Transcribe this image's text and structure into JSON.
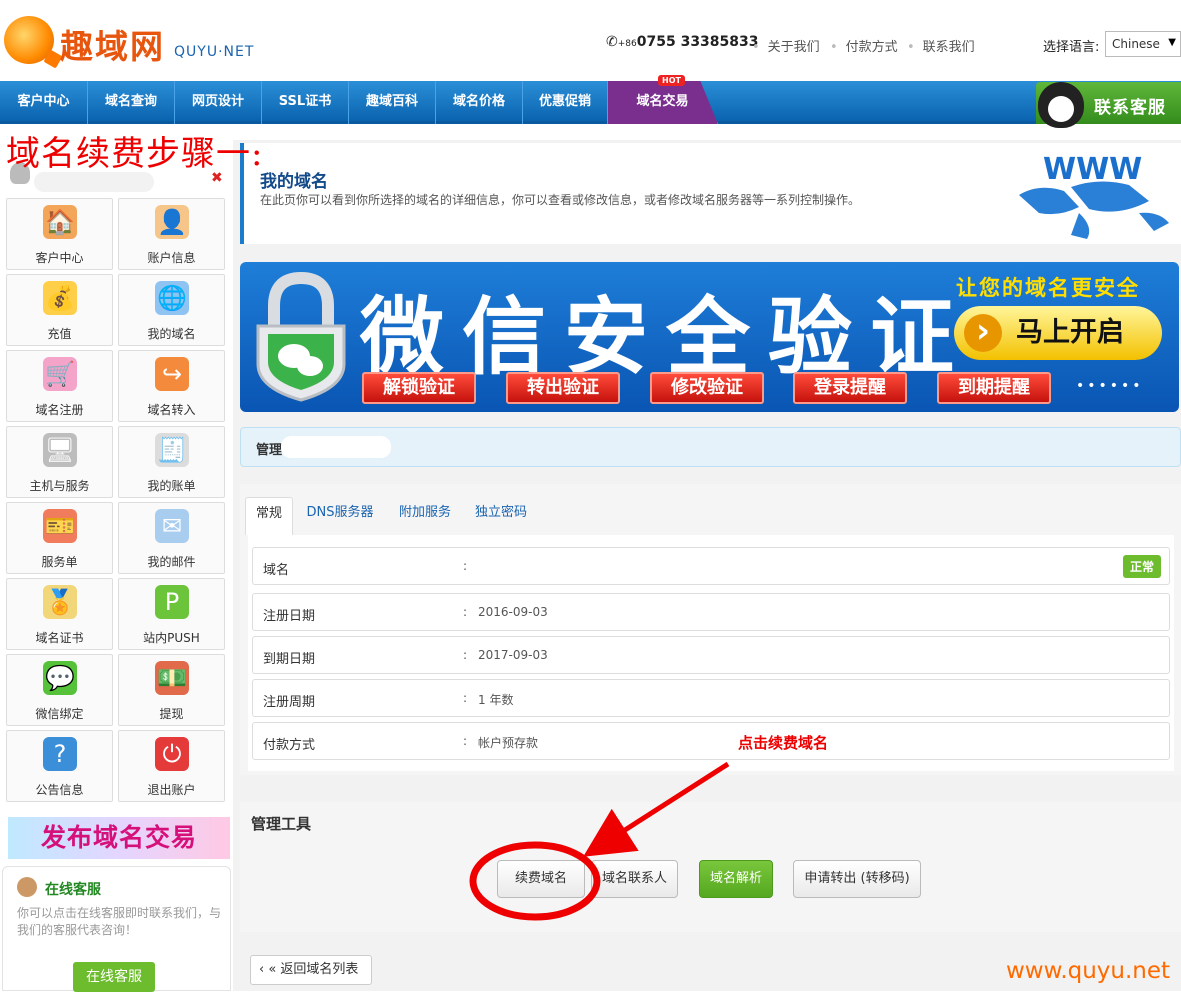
{
  "header": {
    "brand_cn": "趣域网",
    "brand_en": "QUYU·NET",
    "phone_prefix": "+86",
    "phone": "0755 33385833",
    "links": [
      "关于我们",
      "付款方式",
      "联系我们"
    ],
    "lang_label": "选择语言:",
    "lang_selected": "Chinese"
  },
  "nav": {
    "items": [
      "客户中心",
      "域名查询",
      "网页设计",
      "SSL证书",
      "趣域百科",
      "域名价格",
      "优惠促销",
      "域名交易"
    ],
    "hot_badge": "HOT",
    "contact_label": "联系客服"
  },
  "step_title": "域名续费步骤一:",
  "sidebar": {
    "tiles": [
      {
        "label": "客户中心",
        "icon": "house-icon",
        "glyph": "🏠",
        "color": "#f3a55a"
      },
      {
        "label": "账户信息",
        "icon": "user-icon",
        "glyph": "👤",
        "color": "#f6c58a"
      },
      {
        "label": "充值",
        "icon": "coins-icon",
        "glyph": "💰",
        "color": "#ffcf4a"
      },
      {
        "label": "我的域名",
        "icon": "globe-icon",
        "glyph": "🌐",
        "color": "#8fc3f2"
      },
      {
        "label": "域名注册",
        "icon": "cart-icon",
        "glyph": "🛒",
        "color": "#f4a3c9"
      },
      {
        "label": "域名转入",
        "icon": "transfer-icon",
        "glyph": "↪",
        "color": "#f48a3c"
      },
      {
        "label": "主机与服务",
        "icon": "server-icon",
        "glyph": "🖥",
        "color": "#bdbdbd"
      },
      {
        "label": "我的账单",
        "icon": "bill-icon",
        "glyph": "🧾",
        "color": "#dcdcdc"
      },
      {
        "label": "服务单",
        "icon": "ticket-icon",
        "glyph": "🎫",
        "color": "#f07c5c"
      },
      {
        "label": "我的邮件",
        "icon": "mail-icon",
        "glyph": "✉",
        "color": "#a9cdef"
      },
      {
        "label": "域名证书",
        "icon": "certificate-icon",
        "glyph": "🏅",
        "color": "#f1d67a"
      },
      {
        "label": "站内PUSH",
        "icon": "push-icon",
        "glyph": "P",
        "color": "#6cc43a"
      },
      {
        "label": "微信绑定",
        "icon": "wechat-icon",
        "glyph": "💬",
        "color": "#55c23a"
      },
      {
        "label": "提现",
        "icon": "cash-icon",
        "glyph": "💵",
        "color": "#e06a4a"
      },
      {
        "label": "公告信息",
        "icon": "question-icon",
        "glyph": "?",
        "color": "#3b8fd9"
      },
      {
        "label": "退出账户",
        "icon": "power-icon",
        "glyph": "⏻",
        "color": "#e53a3a"
      }
    ],
    "publish_banner": "发布域名交易",
    "online_title": "在线客服",
    "online_desc": "你可以点击在线客服即时联系我们，与我们的客服代表咨询！",
    "online_button": "在线客服"
  },
  "domain_header": {
    "title": "我的域名",
    "desc": "在此页你可以看到你所选择的域名的详细信息，你可以查看或修改信息，或者修改域名服务器等一系列控制操作。"
  },
  "banner": {
    "big": "微信安全验证",
    "slogan": "让您的域名更安全",
    "go": "马上开启",
    "buttons": [
      "解锁验证",
      "转出验证",
      "修改验证",
      "登录提醒",
      "到期提醒"
    ],
    "dots": "••••••"
  },
  "manage_bar": {
    "title": "管理"
  },
  "tabs": [
    "常规",
    "DNS服务器",
    "附加服务",
    "独立密码"
  ],
  "details": [
    {
      "key": "域名",
      "value": ""
    },
    {
      "key": "注册日期",
      "value": "2016-09-03"
    },
    {
      "key": "到期日期",
      "value": "2017-09-03"
    },
    {
      "key": "注册周期",
      "value": "1 年数"
    },
    {
      "key": "付款方式",
      "value": "帐户预存款"
    }
  ],
  "colon": ":",
  "status_badge": "正常",
  "annotation": "点击续费域名",
  "tools": {
    "title": "管理工具",
    "buttons": [
      "续费域名",
      "域名联系人",
      "域名解析",
      "申请转出 (转移码)"
    ]
  },
  "back_button": "« 返回域名列表",
  "watermark": "www.quyu.net",
  "colors": {
    "nav_blue": "#0b63b0",
    "trade_purple": "#7a2f8f",
    "annotation_red": "#e00",
    "green": "#6cbc2e"
  }
}
